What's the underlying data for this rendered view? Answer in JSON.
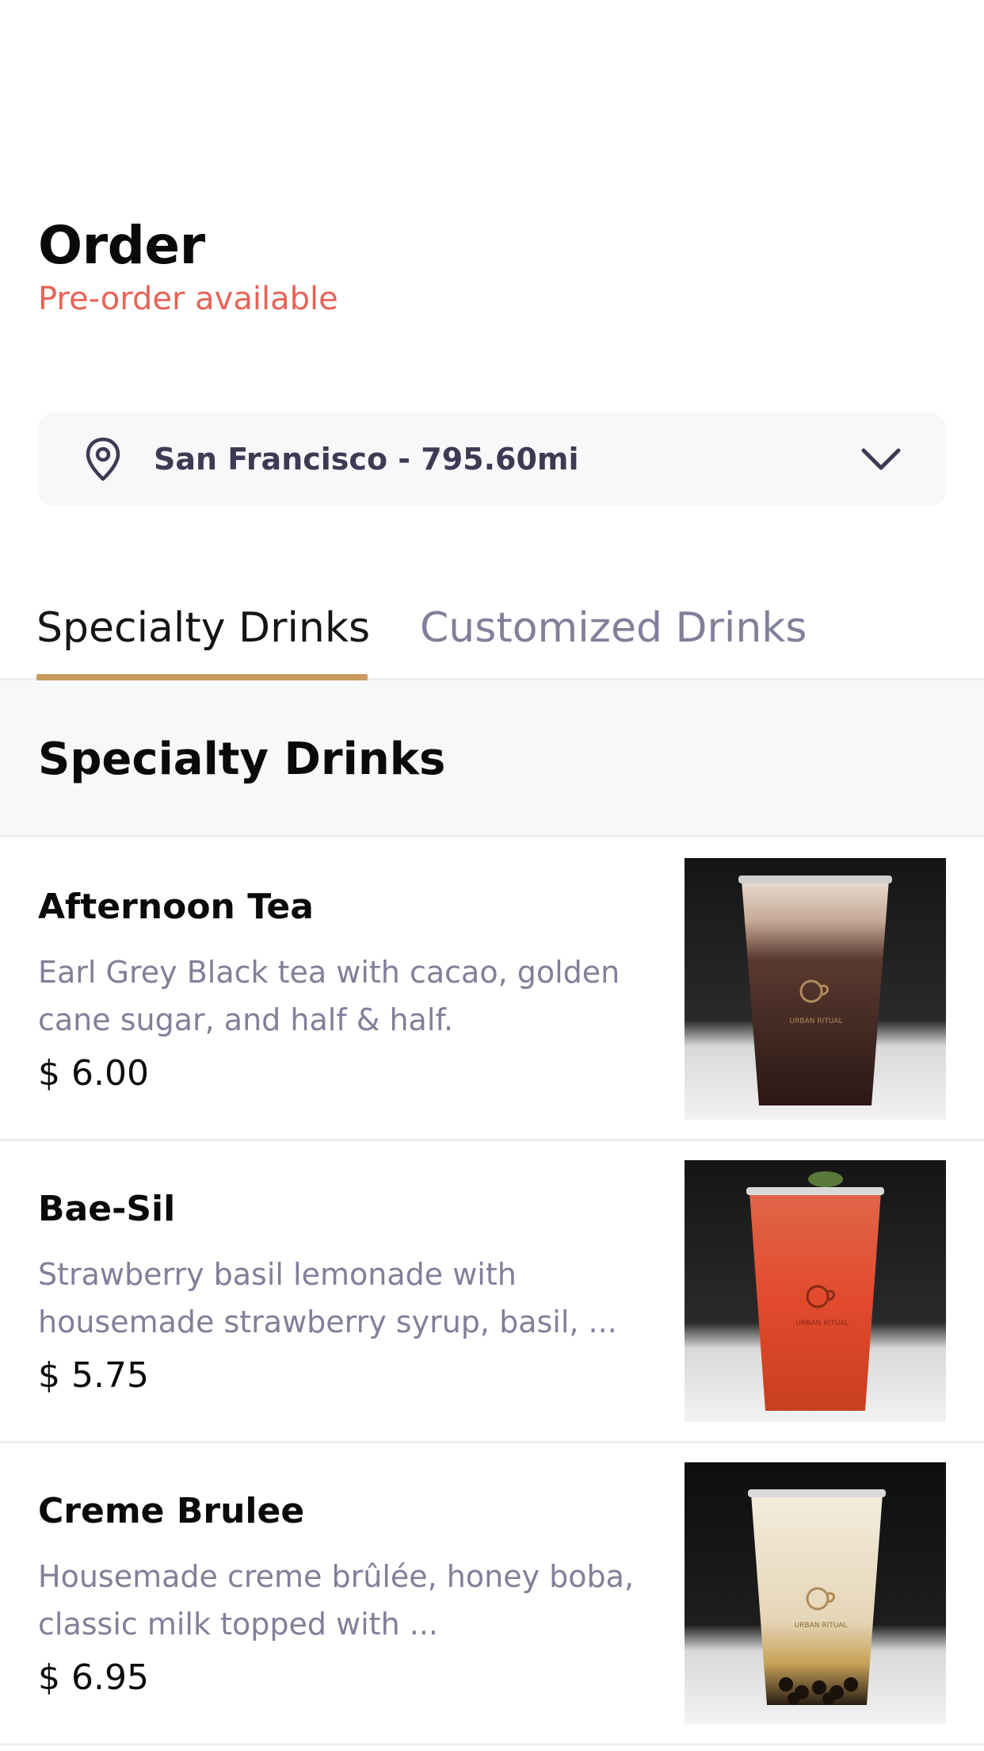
{
  "header": {
    "title": "Order",
    "subtitle": "Pre-order available"
  },
  "location": {
    "icon": "location-pin-icon",
    "label": "San Francisco - 795.60mi",
    "dropdown_icon": "chevron-down-icon"
  },
  "tabs": [
    {
      "label": "Specialty Drinks",
      "active": true
    },
    {
      "label": "Customized Drinks",
      "active": false
    }
  ],
  "section": {
    "title": "Specialty Drinks"
  },
  "items": [
    {
      "name": "Afternoon Tea",
      "description": "Earl Grey Black tea with cacao, golden cane sugar, and half & half.",
      "price": "$ 6.00",
      "cup_text": "URBAN RITUAL"
    },
    {
      "name": "Bae-Sil",
      "description": "Strawberry basil lemonade with housemade strawberry syrup, basil, ...",
      "price": "$ 5.75",
      "cup_text": "URBAN RITUAL"
    },
    {
      "name": "Creme Brulee",
      "description": "Housemade creme brûlée, honey boba, classic milk topped with ...",
      "price": "$ 6.95",
      "cup_text": "URBAN RITUAL"
    }
  ],
  "colors": {
    "accent": "#c99a5f",
    "subtitle": "#e66457",
    "muted_text": "#80809a",
    "panel_bg": "#f7f8fa"
  }
}
